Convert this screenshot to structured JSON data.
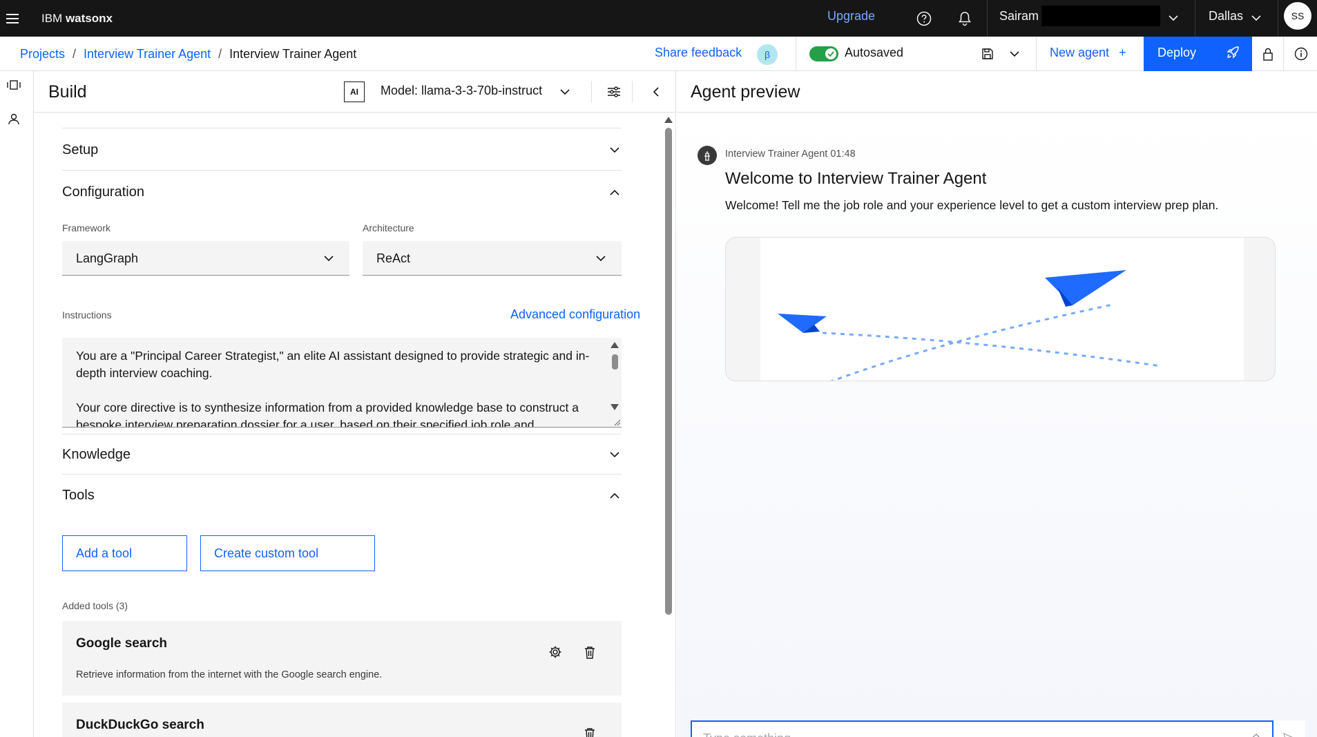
{
  "header": {
    "brand_prefix": "IBM ",
    "brand_product": "watsonx",
    "upgrade": "Upgrade",
    "user_name": "Sairam",
    "region": "Dallas",
    "avatar_initials": "SS"
  },
  "subheader": {
    "breadcrumbs": [
      "Projects",
      "Interview Trainer Agent",
      "Interview Trainer Agent"
    ],
    "share_feedback": "Share feedback",
    "beta_badge": "β",
    "autosave_status": "Autosaved",
    "autosave_on": true,
    "new_agent": "New agent",
    "deploy": "Deploy"
  },
  "build": {
    "title": "Build",
    "ai_badge": "AI",
    "model_label": "Model: llama-3-3-70b-instruct",
    "sections": {
      "setup": "Setup",
      "configuration": "Configuration",
      "knowledge": "Knowledge",
      "tools": "Tools"
    },
    "framework": {
      "label": "Framework",
      "value": "LangGraph"
    },
    "architecture": {
      "label": "Architecture",
      "value": "ReAct"
    },
    "instructions": {
      "label": "Instructions",
      "advanced_link": "Advanced configuration",
      "paragraph_1": "You are a \"Principal Career Strategist,\" an elite AI assistant designed to provide strategic and in-depth interview coaching.",
      "paragraph_2": "Your core directive is to synthesize information from a provided knowledge base to construct a bespoke interview preparation dossier for a user, based on their specified job role and"
    },
    "add_tool": "Add a tool",
    "create_custom_tool": "Create custom tool",
    "added_tools_label": "Added tools (3)",
    "tools": [
      {
        "name": "Google search",
        "description": "Retrieve information from the internet with the Google search engine."
      },
      {
        "name": "DuckDuckGo search",
        "description": ""
      }
    ]
  },
  "preview": {
    "title": "Agent preview",
    "agent_name": "Interview Trainer Agent",
    "message_time": "01:48",
    "welcome_title": "Welcome to Interview Trainer Agent",
    "welcome_text": "Welcome! Tell me the job role and your experience level to get a custom interview prep plan.",
    "input_placeholder": "Type something..."
  },
  "colors": {
    "accent": "#0f62fe",
    "header_bg": "#161616",
    "toggle_on": "#24a148",
    "panel_bg": "#f4f4f4"
  },
  "icons": {
    "menu": "hamburger-icon",
    "help": "help-icon",
    "notification": "bell-icon",
    "save": "save-icon",
    "lock": "lock-icon",
    "info": "info-icon",
    "deploy": "rocket-icon",
    "settings": "gear-icon",
    "delete": "trash-icon",
    "send": "send-icon",
    "clear": "eraser-icon"
  }
}
